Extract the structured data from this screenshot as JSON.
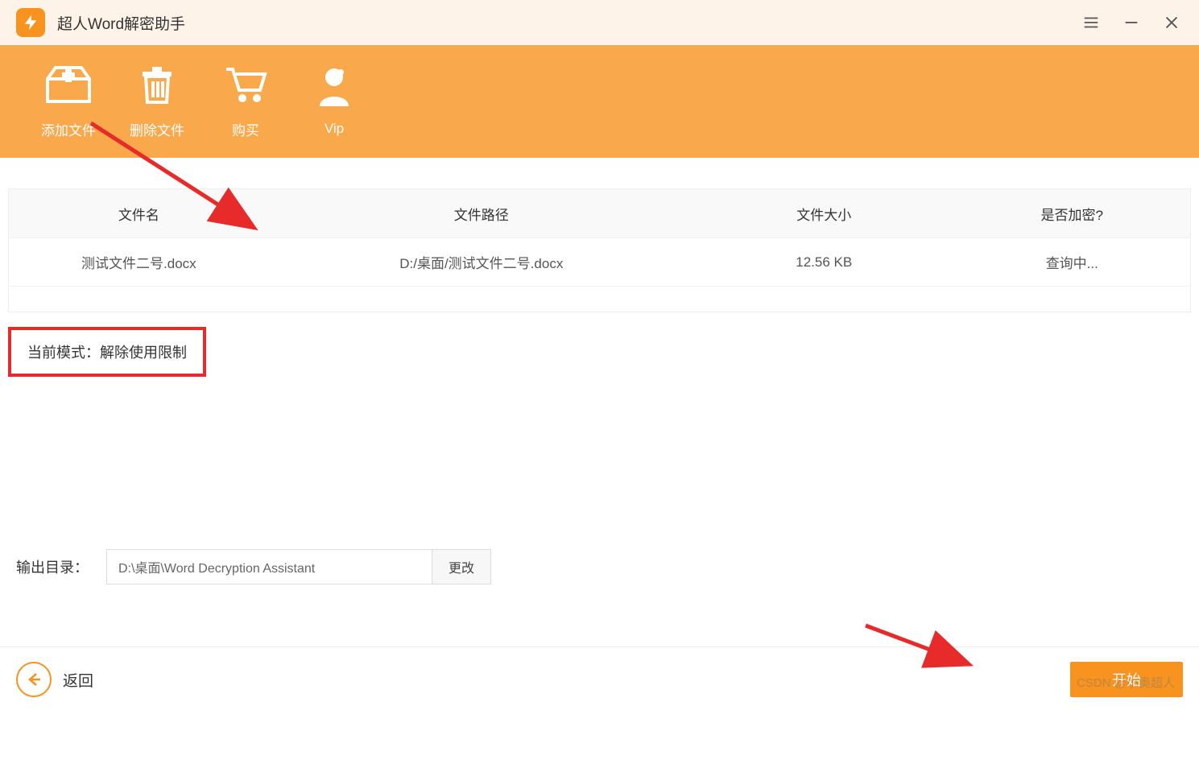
{
  "app": {
    "title": "超人Word解密助手"
  },
  "toolbar": {
    "add_file": "添加文件",
    "delete_file": "删除文件",
    "buy": "购买",
    "vip": "Vip"
  },
  "table": {
    "headers": {
      "name": "文件名",
      "path": "文件路径",
      "size": "文件大小",
      "encrypted": "是否加密?"
    },
    "rows": [
      {
        "name": "测试文件二号.docx",
        "path": "D:/桌面/测试文件二号.docx",
        "size": "12.56 KB",
        "encrypted": "查询中..."
      }
    ]
  },
  "mode": {
    "label": "当前模式：解除使用限制"
  },
  "output": {
    "label": "输出目录：",
    "value": "D:\\桌面\\Word Decryption Assistant",
    "change": "更改"
  },
  "footer": {
    "back": "返回",
    "start": "开始"
  },
  "watermark": "CSDN @小奥超人"
}
